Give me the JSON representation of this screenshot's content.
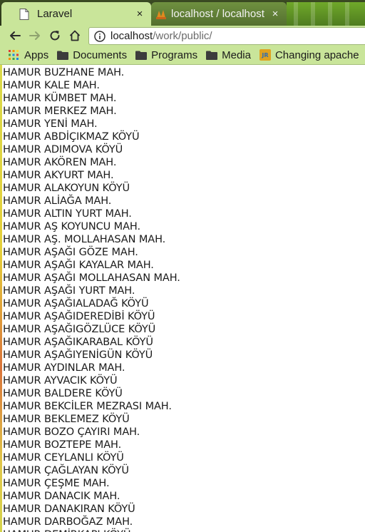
{
  "tabs": [
    {
      "title": "Laravel",
      "favicon": "page-icon",
      "close": "×"
    },
    {
      "title": "localhost / localhost",
      "favicon": "phpmyadmin-icon",
      "close": "×"
    }
  ],
  "omnibox": {
    "host": "localhost",
    "path": "/work/public/"
  },
  "bookmarks": [
    {
      "label": "Apps",
      "icon": "apps-grid-icon"
    },
    {
      "label": "Documents",
      "icon": "folder-icon"
    },
    {
      "label": "Programs",
      "icon": "folder-icon"
    },
    {
      "label": "Media",
      "icon": "folder-icon"
    },
    {
      "label": "Changing apache",
      "icon": "jr-blog-icon"
    }
  ],
  "neighborhoods": [
    "HAMUR BUZHANE MAH.",
    "HAMUR KALE MAH.",
    "HAMUR KÜMBET MAH.",
    "HAMUR MERKEZ MAH.",
    "HAMUR YENİ MAH.",
    "HAMUR ABDİÇIKMAZ KÖYÜ",
    "HAMUR ADIMOVA KÖYÜ",
    "HAMUR AKÖREN MAH.",
    "HAMUR AKYURT MAH.",
    "HAMUR ALAKOYUN KÖYÜ",
    "HAMUR ALİAĞA MAH.",
    "HAMUR ALTIN YURT MAH.",
    "HAMUR AŞ KOYUNCU MAH.",
    "HAMUR AŞ. MOLLAHASAN MAH.",
    "HAMUR AŞAĞI GÖZE MAH.",
    "HAMUR AŞAĞI KAYALAR MAH.",
    "HAMUR AŞAĞI MOLLAHASAN MAH.",
    "HAMUR AŞAĞI YURT MAH.",
    "HAMUR AŞAĞIALADAĞ KÖYÜ",
    "HAMUR AŞAĞIDEREDİBİ KÖYÜ",
    "HAMUR AŞAĞIGÖZLÜCE KÖYÜ",
    "HAMUR AŞAĞIKARABAL KÖYÜ",
    "HAMUR AŞAĞIYENİGÜN KÖYÜ",
    "HAMUR AYDINLAR MAH.",
    "HAMUR AYVACIK KÖYÜ",
    "HAMUR BALDERE KÖYÜ",
    "HAMUR BEKCİLER MEZRASI MAH.",
    "HAMUR BEKLEMEZ KÖYÜ",
    "HAMUR BOZO ÇAYIRI MAH.",
    "HAMUR BOZTEPE MAH.",
    "HAMUR CEYLANLI KÖYÜ",
    "HAMUR ÇAĞLAYAN KÖYÜ",
    "HAMUR ÇEŞME MAH.",
    "HAMUR DANACIK MAH.",
    "HAMUR DANAKIRAN KÖYÜ",
    "HAMUR DARBOĞAZ MAH.",
    "HAMUR DEMİRKAPI KÖYÜ"
  ]
}
